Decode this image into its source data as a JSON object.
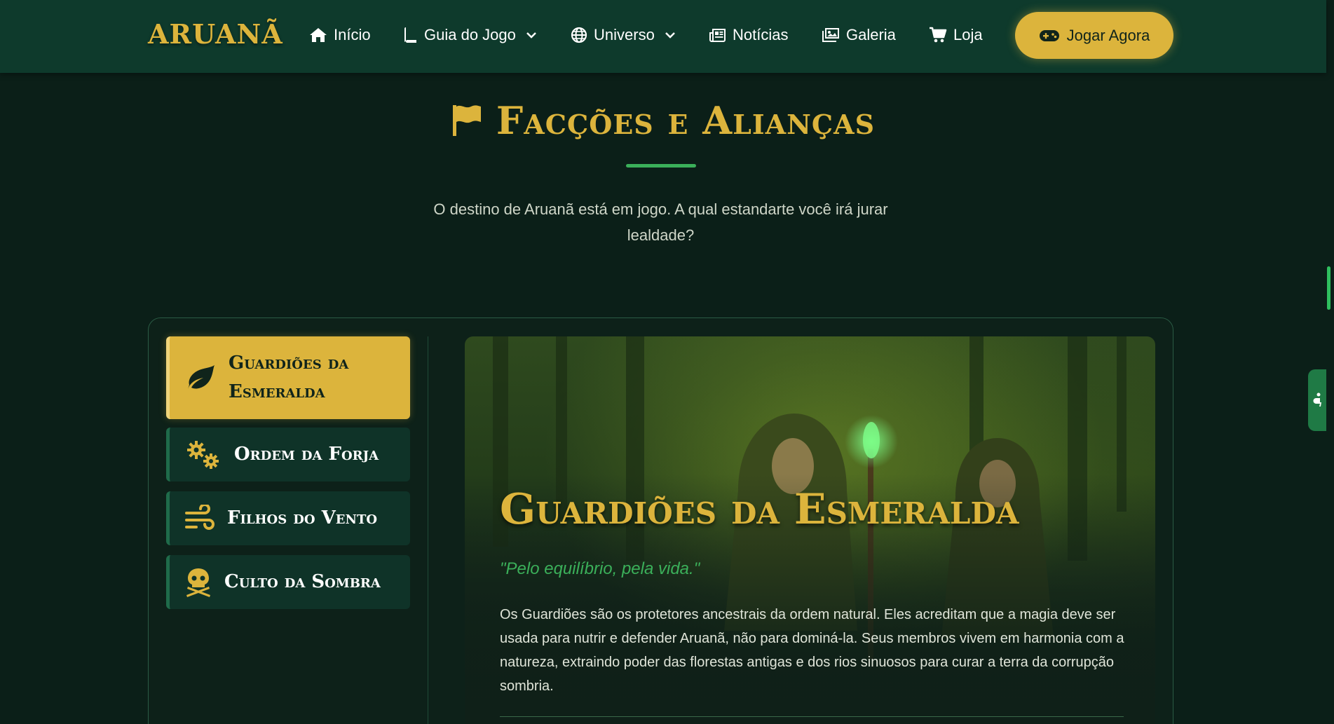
{
  "brand": {
    "logo": "ARUANÃ"
  },
  "nav": {
    "items": [
      {
        "label": "Início",
        "icon": "home-icon"
      },
      {
        "label": "Guia do Jogo",
        "icon": "book-icon",
        "dropdown": true
      },
      {
        "label": "Universo",
        "icon": "globe-icon",
        "dropdown": true
      },
      {
        "label": "Notícias",
        "icon": "newspaper-icon"
      },
      {
        "label": "Galeria",
        "icon": "images-icon"
      },
      {
        "label": "Loja",
        "icon": "cart-icon"
      }
    ],
    "cta": {
      "label": "Jogar Agora",
      "icon": "gamepad-icon"
    }
  },
  "section": {
    "title": "Facções e Alianças",
    "icon": "flag-icon",
    "subtitle": "O destino de Aruanã está em jogo. A qual estandarte você irá jurar lealdade?"
  },
  "factions": [
    {
      "label": "Guardiões da Esmeralda",
      "icon": "leaf-icon",
      "active": true
    },
    {
      "label": "Ordem da Forja",
      "icon": "gears-icon",
      "active": false
    },
    {
      "label": "Filhos do Vento",
      "icon": "wind-icon",
      "active": false
    },
    {
      "label": "Culto da Sombra",
      "icon": "skull-crossbones-icon",
      "active": false
    }
  ],
  "detail": {
    "title": "Guardiões da Esmeralda",
    "motto": "\"Pelo equilíbrio, pela vida.\"",
    "description": "Os Guardiões são os protetores ancestrais da ordem natural. Eles acreditam que a magia deve ser usada para nutrir e defender Aruanã, não para dominá-la. Seus membros vivem em harmonia com a natureza, extraindo poder das florestas antigas e dos rios sinuosos para curar a terra da corrupção sombria."
  },
  "colors": {
    "background": "#0b1f18",
    "navbar": "#0e3a2c",
    "accent_gold": "#dcb43c",
    "accent_green": "#3bb05a",
    "tab_inactive": "#0f3328"
  }
}
